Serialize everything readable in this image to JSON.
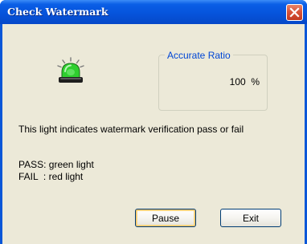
{
  "window": {
    "title": "Check Watermark"
  },
  "status": {
    "light_color": "#2fcf2f",
    "light_icon": "green-beacon-icon"
  },
  "ratio": {
    "label": "Accurate Ratio",
    "value": "100  %"
  },
  "description": "This light indicates watermark verification pass or fail",
  "legend": {
    "pass": "PASS: green light",
    "fail": "FAIL  : red light"
  },
  "buttons": {
    "pause": "Pause",
    "exit": "Exit"
  },
  "colors": {
    "titlebar": "#0654dc",
    "client_bg": "#ece9d8",
    "legend_text": "#0046d5",
    "close_button": "#d8543a"
  }
}
